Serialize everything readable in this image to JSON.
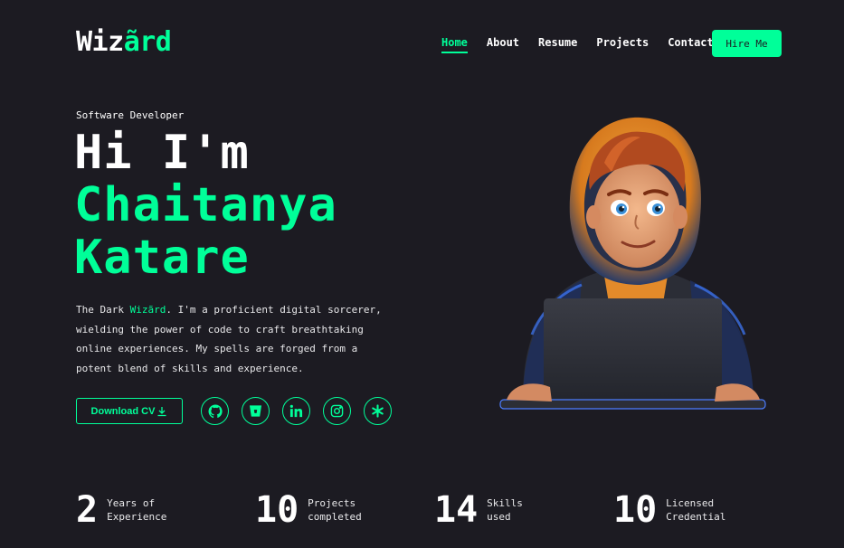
{
  "header": {
    "logo_text": "Wiz",
    "logo_accent": "ãrd",
    "nav": [
      "Home",
      "About",
      "Resume",
      "Projects",
      "Contact"
    ],
    "active_nav": "Home",
    "hire_label": "Hire Me"
  },
  "hero": {
    "role": "Software Developer",
    "greeting": "Hi I'm",
    "name_line1": "Chaitanya",
    "name_line2": "Katare",
    "bio_prefix": "The Dark ",
    "bio_accent": "Wizãrd",
    "bio_rest": ". I'm a proficient digital sorcerer, wielding the power of code to craft breathtaking online experiences. My spells are forged from a potent blend of skills and experience.",
    "cv_label": "Download CV",
    "socials": [
      "github-icon",
      "bitbucket-icon",
      "linkedin-icon",
      "instagram-icon",
      "asterisk-icon"
    ]
  },
  "stats": [
    {
      "number": "2",
      "label": "Years of\nExperience"
    },
    {
      "number": "10",
      "label": "Projects\ncompleted"
    },
    {
      "number": "14",
      "label": "Skills\nused"
    },
    {
      "number": "10",
      "label": "Licensed\nCredential"
    }
  ],
  "colors": {
    "background": "#1c1b22",
    "accent": "#00ff99",
    "text": "#ffffff"
  }
}
